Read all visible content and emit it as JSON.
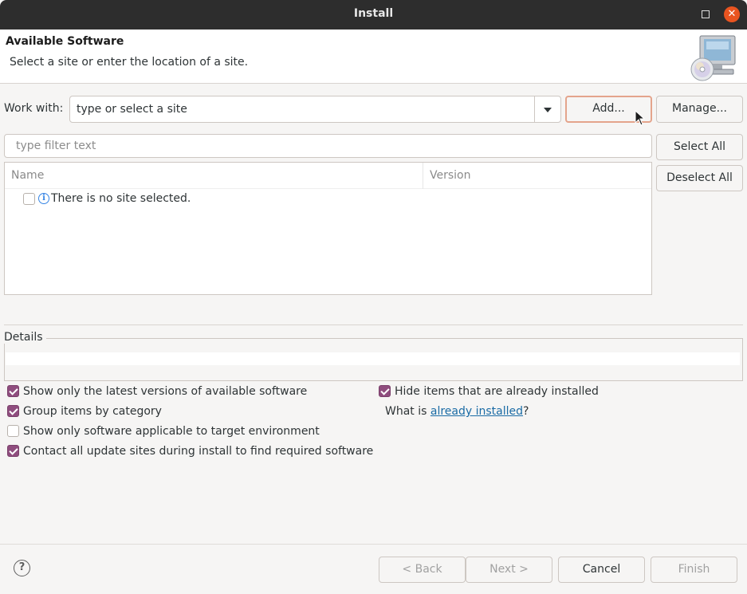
{
  "window": {
    "title": "Install",
    "maximize_icon": "maximize-icon",
    "close_icon": "close-icon",
    "close_glyph": "✕"
  },
  "banner": {
    "heading": "Available Software",
    "description": "Select a site or enter the location of a site.",
    "image_icon": "computer-cd-icon"
  },
  "work_with": {
    "label": "Work with:",
    "value": "type or select a site",
    "add_label": "Add...",
    "manage_label": "Manage..."
  },
  "filter": {
    "placeholder": "type filter text"
  },
  "side_buttons": {
    "select_all": "Select All",
    "deselect_all": "Deselect All"
  },
  "table": {
    "columns": [
      "Name",
      "Version"
    ],
    "rows": [
      {
        "checked": false,
        "icon": "info-icon",
        "name": "There is no site selected.",
        "version": ""
      }
    ]
  },
  "details": {
    "label": "Details",
    "text": ""
  },
  "options": {
    "latest_versions": {
      "label": "Show only the latest versions of available software",
      "checked": true
    },
    "group_by_category": {
      "label": "Group items by category",
      "checked": true
    },
    "target_env": {
      "label": "Show only software applicable to target environment",
      "checked": false
    },
    "contact_sites": {
      "label": "Contact all update sites during install to find required software",
      "checked": true
    },
    "hide_installed": {
      "label": "Hide items that are already installed",
      "checked": true
    },
    "what_is": {
      "prefix": "What is ",
      "link": "already installed",
      "suffix": "?"
    }
  },
  "footer": {
    "help_icon": "help-icon",
    "help_glyph": "?",
    "back": "< Back",
    "next": "Next >",
    "cancel": "Cancel",
    "finish": "Finish"
  },
  "colors": {
    "accent": "#8f4d7e",
    "focus": "#e4a48c",
    "close": "#e95420",
    "link": "#1a6ba5"
  }
}
